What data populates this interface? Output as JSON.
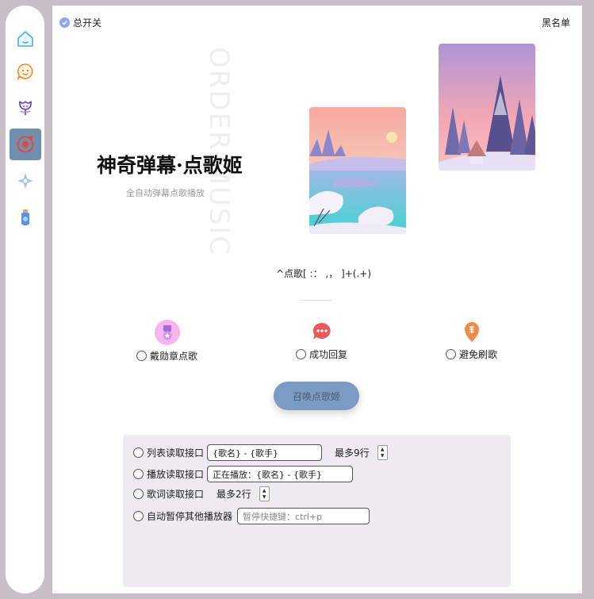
{
  "sidebar": {
    "items": [
      {
        "icon": "home-icon"
      },
      {
        "icon": "chat-bubble-icon"
      },
      {
        "icon": "flower-icon"
      },
      {
        "icon": "music-request-icon",
        "active": true
      },
      {
        "icon": "sparkle-icon"
      },
      {
        "icon": "bottle-icon"
      }
    ]
  },
  "header": {
    "master_switch_label": "总开关",
    "blacklist_label": "黑名单"
  },
  "hero": {
    "watermark": "ORDER MUSIC",
    "title": "神奇弹幕·点歌姬",
    "subtitle": "全自动弹幕点歌播放"
  },
  "regex": "^点歌[ :： ,， ]+(.+)",
  "options": [
    {
      "label": "戴勋章点歌",
      "icon": "medal-icon",
      "color": "#f3a6e5"
    },
    {
      "label": "成功回复",
      "icon": "reply-bubble-icon",
      "color": "#ea5a5a"
    },
    {
      "label": "避免刷歌",
      "icon": "shield-location-icon",
      "color": "#ef8b4a"
    }
  ],
  "summon_button": "召唤点歌姬",
  "settings": {
    "list_api_label": "列表读取接口",
    "list_api_value": "{歌名} - {歌手}",
    "list_max_label": "最多9行",
    "play_api_label": "播放读取接口",
    "play_api_value": "正在播放：{歌名} - {歌手}",
    "lyric_api_label": "歌词读取接口",
    "lyric_max_label": "最多2行",
    "auto_pause_label": "自动暂停其他播放器",
    "pause_hotkey_placeholder": "暂停快捷键：ctrl+p"
  },
  "colors": {
    "accent": "#7a9cc4",
    "sidebar_active": "#6f8fad",
    "panel_bg": "#efe9f1",
    "window_bg": "#c7bec7"
  }
}
